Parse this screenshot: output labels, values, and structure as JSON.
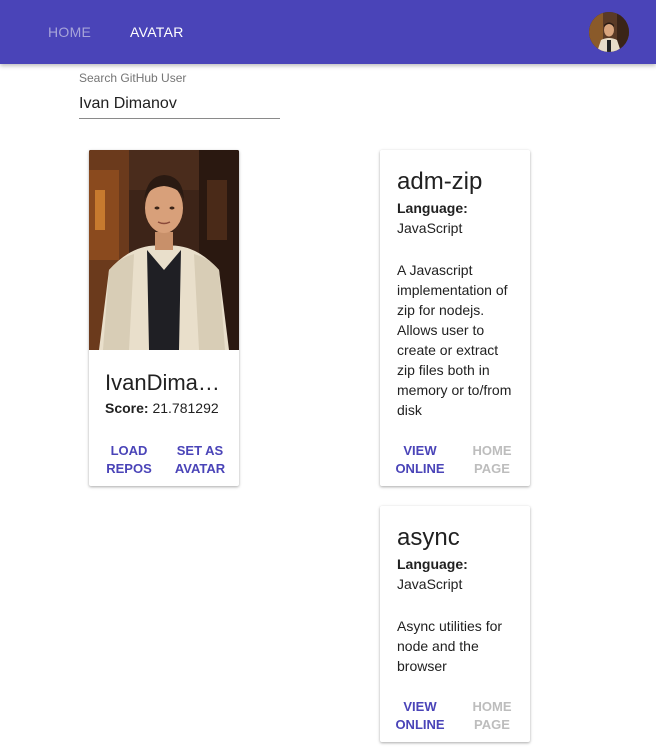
{
  "appbar": {
    "tabs": [
      {
        "label": "HOME",
        "active": false
      },
      {
        "label": "AVATAR",
        "active": true
      }
    ],
    "accent_color": "#4a44b8"
  },
  "search": {
    "label": "Search GitHub User",
    "value": "Ivan Dimanov"
  },
  "user": {
    "name": "IvanDima…",
    "score_label": "Score:",
    "score": "21.781292",
    "actions": [
      "LOAD REPOS",
      "SET AS AVATAR"
    ]
  },
  "repos": [
    {
      "title": "adm-zip",
      "language_label": "Language:",
      "language": "JavaScript",
      "description": "A Javascript implementation of zip for nodejs. Allows user to create or extract zip files both in memory or to/from disk",
      "actions": [
        {
          "label": "VIEW ONLINE",
          "enabled": true
        },
        {
          "label": "HOME PAGE",
          "enabled": false
        }
      ]
    },
    {
      "title": "async",
      "language_label": "Language:",
      "language": "JavaScript",
      "description": "Async utilities for node and the browser",
      "actions": [
        {
          "label": "VIEW ONLINE",
          "enabled": true
        },
        {
          "label": "HOME PAGE",
          "enabled": false
        }
      ]
    }
  ]
}
